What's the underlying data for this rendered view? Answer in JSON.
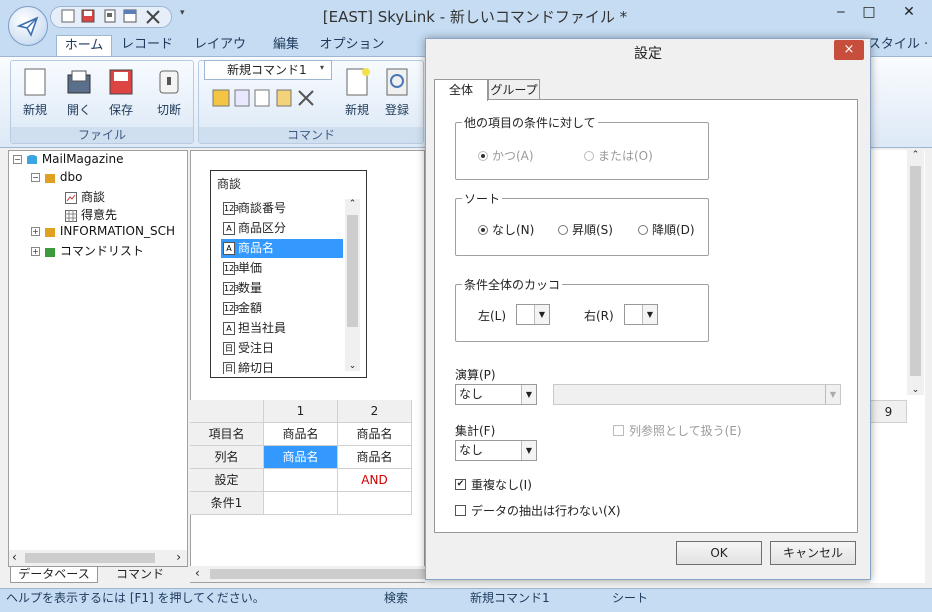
{
  "window": {
    "title": "[EAST] SkyLink - 新しいコマンドファイル *",
    "minimize": "‒",
    "maximize": "□",
    "close": "✕"
  },
  "ribbon": {
    "tabs": [
      "ホーム",
      "レコード",
      "レイアウト",
      "編集",
      "オプション"
    ],
    "style_label": "スタイル ·",
    "file_group": {
      "label": "ファイル",
      "buttons": [
        "新規",
        "開く",
        "保存",
        "切断"
      ]
    },
    "command_group": {
      "label": "コマンド",
      "combo_value": "新規コマンド1",
      "buttons": [
        "新規",
        "登録"
      ]
    }
  },
  "tree": {
    "root": "MailMagazine",
    "schema": "dbo",
    "tables": [
      "商談",
      "得意先"
    ],
    "info_schema": "INFORMATION_SCH",
    "command_list": "コマンドリスト",
    "tabs": [
      "データベース",
      "コマンド"
    ]
  },
  "table_box": {
    "title": "商談",
    "fields": [
      {
        "icon": "123",
        "name": "商談番号"
      },
      {
        "icon": "A",
        "name": "商品区分"
      },
      {
        "icon": "A",
        "name": "商品名"
      },
      {
        "icon": "123",
        "name": "単価"
      },
      {
        "icon": "123",
        "name": "数量"
      },
      {
        "icon": "123",
        "name": "金額"
      },
      {
        "icon": "A",
        "name": "担当社員"
      },
      {
        "icon": "日",
        "name": "受注日"
      },
      {
        "icon": "日",
        "name": "締切日"
      }
    ],
    "selected_index": 2
  },
  "grid": {
    "columns": [
      "1",
      "2"
    ],
    "last_column": "9",
    "row_labels": [
      "項目名",
      "列名",
      "設定",
      "条件1"
    ],
    "cells": [
      [
        "商品名",
        "商品名"
      ],
      [
        "商品名",
        "商品名"
      ],
      [
        "",
        "AND"
      ],
      [
        "",
        ""
      ]
    ]
  },
  "status": {
    "help": "ヘルプを表示するには [F1] を押してください。",
    "mode": "検索",
    "command": "新規コマンド1",
    "sheet": "シート"
  },
  "dialog": {
    "title": "設定",
    "close": "×",
    "tabs": [
      "全体",
      "グループ"
    ],
    "condition_group": {
      "label": "他の項目の条件に対して",
      "options": [
        "かつ(A)",
        "または(O)"
      ],
      "selected": 0
    },
    "sort_group": {
      "label": "ソート",
      "options": [
        "なし(N)",
        "昇順(S)",
        "降順(D)"
      ],
      "selected": 0
    },
    "paren_group": {
      "label": "条件全体のカッコ",
      "left_label": "左(L)",
      "right_label": "右(R)",
      "left_value": "",
      "right_value": ""
    },
    "operation": {
      "label": "演算(P)",
      "value": "なし",
      "expr": ""
    },
    "aggregate": {
      "label": "集計(F)",
      "value": "なし",
      "column_ref_label": "列参照として扱う(E)"
    },
    "no_duplicates": {
      "label": "重複なし(I)",
      "checked": true
    },
    "no_extract": {
      "label": "データの抽出は行わない(X)",
      "checked": false
    },
    "ok": "OK",
    "cancel": "キャンセル"
  }
}
